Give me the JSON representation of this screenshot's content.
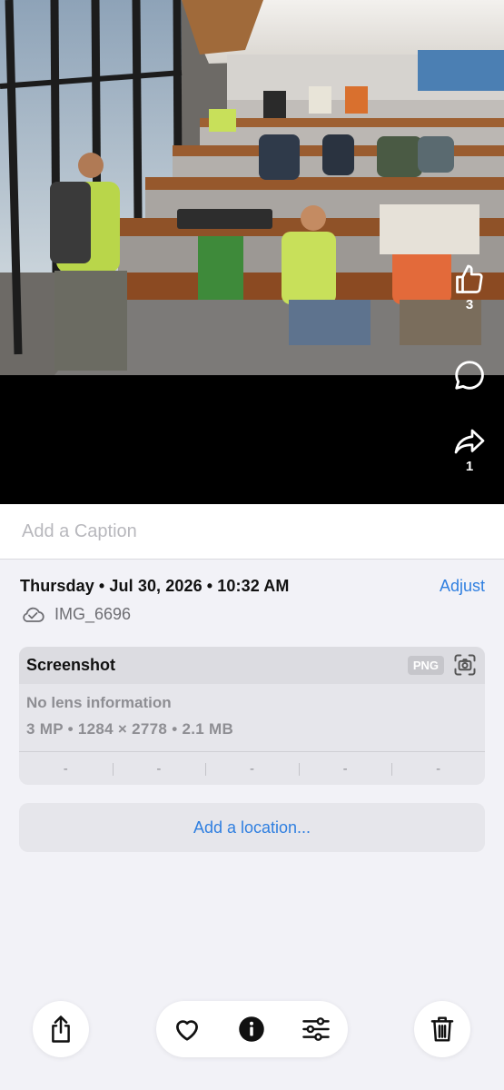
{
  "photo": {
    "like_count": "3",
    "share_count": "1"
  },
  "caption": {
    "placeholder": "Add a Caption"
  },
  "details": {
    "date_time": "Thursday • Jul 30, 2026 • 10:32 AM",
    "adjust_label": "Adjust",
    "filename": "IMG_6696",
    "cloud_icon": "cloud-check-icon"
  },
  "info_card": {
    "title": "Screenshot",
    "format_badge": "PNG",
    "lens": "No lens information",
    "specs": "3 MP • 1284 × 2778 • 2.1 MB",
    "exif": [
      "-",
      "-",
      "-",
      "-",
      "-"
    ]
  },
  "location": {
    "label": "Add a location..."
  },
  "toolbar": {
    "icons": [
      "share-icon",
      "heart-icon",
      "info-icon",
      "adjustments-icon",
      "trash-icon"
    ]
  },
  "colors": {
    "accent": "#2f7fe0",
    "background": "#f2f2f7",
    "card": "#e6e6eb"
  }
}
